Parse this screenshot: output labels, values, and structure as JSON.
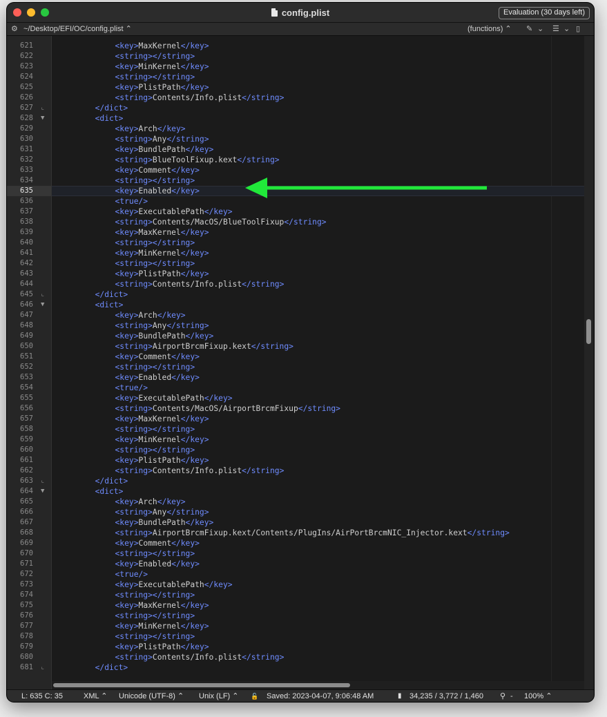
{
  "window": {
    "title": "config.plist",
    "evaluation_badge": "Evaluation (30 days left)"
  },
  "toolbar": {
    "gear_icon": "⚙",
    "path": "~/Desktop/EFI/OC/config.plist ⌃",
    "functions": "(functions) ⌃",
    "pin_icon": "✎",
    "chevron1": "⌄",
    "list_icon": "☰",
    "chevron2": "⌄",
    "doc_icon": "▯"
  },
  "editor": {
    "current_line": 635,
    "lines": [
      {
        "n": "621",
        "indent": 5,
        "p": [
          [
            "t",
            "<key>"
          ],
          [
            "x",
            "MaxKernel"
          ],
          [
            "t",
            "</key>"
          ]
        ]
      },
      {
        "n": "622",
        "indent": 5,
        "p": [
          [
            "t",
            "<string></string>"
          ]
        ]
      },
      {
        "n": "623",
        "indent": 5,
        "p": [
          [
            "t",
            "<key>"
          ],
          [
            "x",
            "MinKernel"
          ],
          [
            "t",
            "</key>"
          ]
        ]
      },
      {
        "n": "624",
        "indent": 5,
        "p": [
          [
            "t",
            "<string></string>"
          ]
        ]
      },
      {
        "n": "625",
        "indent": 5,
        "p": [
          [
            "t",
            "<key>"
          ],
          [
            "x",
            "PlistPath"
          ],
          [
            "t",
            "</key>"
          ]
        ]
      },
      {
        "n": "626",
        "indent": 5,
        "p": [
          [
            "t",
            "<string>"
          ],
          [
            "x",
            "Contents/Info.plist"
          ],
          [
            "t",
            "</string>"
          ]
        ]
      },
      {
        "n": "627",
        "indent": 4,
        "fold": "close",
        "p": [
          [
            "t",
            "</dict>"
          ]
        ]
      },
      {
        "n": "628",
        "indent": 4,
        "fold": "open",
        "p": [
          [
            "t",
            "<dict>"
          ]
        ]
      },
      {
        "n": "629",
        "indent": 5,
        "p": [
          [
            "t",
            "<key>"
          ],
          [
            "x",
            "Arch"
          ],
          [
            "t",
            "</key>"
          ]
        ]
      },
      {
        "n": "630",
        "indent": 5,
        "p": [
          [
            "t",
            "<string>"
          ],
          [
            "x",
            "Any"
          ],
          [
            "t",
            "</string>"
          ]
        ]
      },
      {
        "n": "631",
        "indent": 5,
        "p": [
          [
            "t",
            "<key>"
          ],
          [
            "x",
            "BundlePath"
          ],
          [
            "t",
            "</key>"
          ]
        ]
      },
      {
        "n": "632",
        "indent": 5,
        "p": [
          [
            "t",
            "<string>"
          ],
          [
            "x",
            "BlueToolFixup.kext"
          ],
          [
            "t",
            "</string>"
          ]
        ]
      },
      {
        "n": "633",
        "indent": 5,
        "p": [
          [
            "t",
            "<key>"
          ],
          [
            "x",
            "Comment"
          ],
          [
            "t",
            "</key>"
          ]
        ]
      },
      {
        "n": "634",
        "indent": 5,
        "p": [
          [
            "t",
            "<string></string>"
          ]
        ]
      },
      {
        "n": "635",
        "indent": 5,
        "p": [
          [
            "t",
            "<key>"
          ],
          [
            "x",
            "Enabled"
          ],
          [
            "t",
            "</key>"
          ]
        ]
      },
      {
        "n": "636",
        "indent": 5,
        "p": [
          [
            "t",
            "<true/>"
          ]
        ]
      },
      {
        "n": "637",
        "indent": 5,
        "p": [
          [
            "t",
            "<key>"
          ],
          [
            "x",
            "ExecutablePath"
          ],
          [
            "t",
            "</key>"
          ]
        ]
      },
      {
        "n": "638",
        "indent": 5,
        "p": [
          [
            "t",
            "<string>"
          ],
          [
            "x",
            "Contents/MacOS/BlueToolFixup"
          ],
          [
            "t",
            "</string>"
          ]
        ]
      },
      {
        "n": "639",
        "indent": 5,
        "p": [
          [
            "t",
            "<key>"
          ],
          [
            "x",
            "MaxKernel"
          ],
          [
            "t",
            "</key>"
          ]
        ]
      },
      {
        "n": "640",
        "indent": 5,
        "p": [
          [
            "t",
            "<string></string>"
          ]
        ]
      },
      {
        "n": "641",
        "indent": 5,
        "p": [
          [
            "t",
            "<key>"
          ],
          [
            "x",
            "MinKernel"
          ],
          [
            "t",
            "</key>"
          ]
        ]
      },
      {
        "n": "642",
        "indent": 5,
        "p": [
          [
            "t",
            "<string></string>"
          ]
        ]
      },
      {
        "n": "643",
        "indent": 5,
        "p": [
          [
            "t",
            "<key>"
          ],
          [
            "x",
            "PlistPath"
          ],
          [
            "t",
            "</key>"
          ]
        ]
      },
      {
        "n": "644",
        "indent": 5,
        "p": [
          [
            "t",
            "<string>"
          ],
          [
            "x",
            "Contents/Info.plist"
          ],
          [
            "t",
            "</string>"
          ]
        ]
      },
      {
        "n": "645",
        "indent": 4,
        "fold": "close",
        "p": [
          [
            "t",
            "</dict>"
          ]
        ]
      },
      {
        "n": "646",
        "indent": 4,
        "fold": "open",
        "p": [
          [
            "t",
            "<dict>"
          ]
        ]
      },
      {
        "n": "647",
        "indent": 5,
        "p": [
          [
            "t",
            "<key>"
          ],
          [
            "x",
            "Arch"
          ],
          [
            "t",
            "</key>"
          ]
        ]
      },
      {
        "n": "648",
        "indent": 5,
        "p": [
          [
            "t",
            "<string>"
          ],
          [
            "x",
            "Any"
          ],
          [
            "t",
            "</string>"
          ]
        ]
      },
      {
        "n": "649",
        "indent": 5,
        "p": [
          [
            "t",
            "<key>"
          ],
          [
            "x",
            "BundlePath"
          ],
          [
            "t",
            "</key>"
          ]
        ]
      },
      {
        "n": "650",
        "indent": 5,
        "p": [
          [
            "t",
            "<string>"
          ],
          [
            "x",
            "AirportBrcmFixup.kext"
          ],
          [
            "t",
            "</string>"
          ]
        ]
      },
      {
        "n": "651",
        "indent": 5,
        "p": [
          [
            "t",
            "<key>"
          ],
          [
            "x",
            "Comment"
          ],
          [
            "t",
            "</key>"
          ]
        ]
      },
      {
        "n": "652",
        "indent": 5,
        "p": [
          [
            "t",
            "<string></string>"
          ]
        ]
      },
      {
        "n": "653",
        "indent": 5,
        "p": [
          [
            "t",
            "<key>"
          ],
          [
            "x",
            "Enabled"
          ],
          [
            "t",
            "</key>"
          ]
        ]
      },
      {
        "n": "654",
        "indent": 5,
        "p": [
          [
            "t",
            "<true/>"
          ]
        ]
      },
      {
        "n": "655",
        "indent": 5,
        "p": [
          [
            "t",
            "<key>"
          ],
          [
            "x",
            "ExecutablePath"
          ],
          [
            "t",
            "</key>"
          ]
        ]
      },
      {
        "n": "656",
        "indent": 5,
        "p": [
          [
            "t",
            "<string>"
          ],
          [
            "x",
            "Contents/MacOS/AirportBrcmFixup"
          ],
          [
            "t",
            "</string>"
          ]
        ]
      },
      {
        "n": "657",
        "indent": 5,
        "p": [
          [
            "t",
            "<key>"
          ],
          [
            "x",
            "MaxKernel"
          ],
          [
            "t",
            "</key>"
          ]
        ]
      },
      {
        "n": "658",
        "indent": 5,
        "p": [
          [
            "t",
            "<string></string>"
          ]
        ]
      },
      {
        "n": "659",
        "indent": 5,
        "p": [
          [
            "t",
            "<key>"
          ],
          [
            "x",
            "MinKernel"
          ],
          [
            "t",
            "</key>"
          ]
        ]
      },
      {
        "n": "660",
        "indent": 5,
        "p": [
          [
            "t",
            "<string></string>"
          ]
        ]
      },
      {
        "n": "661",
        "indent": 5,
        "p": [
          [
            "t",
            "<key>"
          ],
          [
            "x",
            "PlistPath"
          ],
          [
            "t",
            "</key>"
          ]
        ]
      },
      {
        "n": "662",
        "indent": 5,
        "p": [
          [
            "t",
            "<string>"
          ],
          [
            "x",
            "Contents/Info.plist"
          ],
          [
            "t",
            "</string>"
          ]
        ]
      },
      {
        "n": "663",
        "indent": 4,
        "fold": "close",
        "p": [
          [
            "t",
            "</dict>"
          ]
        ]
      },
      {
        "n": "664",
        "indent": 4,
        "fold": "open",
        "p": [
          [
            "t",
            "<dict>"
          ]
        ]
      },
      {
        "n": "665",
        "indent": 5,
        "p": [
          [
            "t",
            "<key>"
          ],
          [
            "x",
            "Arch"
          ],
          [
            "t",
            "</key>"
          ]
        ]
      },
      {
        "n": "666",
        "indent": 5,
        "p": [
          [
            "t",
            "<string>"
          ],
          [
            "x",
            "Any"
          ],
          [
            "t",
            "</string>"
          ]
        ]
      },
      {
        "n": "667",
        "indent": 5,
        "p": [
          [
            "t",
            "<key>"
          ],
          [
            "x",
            "BundlePath"
          ],
          [
            "t",
            "</key>"
          ]
        ]
      },
      {
        "n": "668",
        "indent": 5,
        "p": [
          [
            "t",
            "<string>"
          ],
          [
            "x",
            "AirportBrcmFixup.kext/Contents/PlugIns/AirPortBrcmNIC_Injector.kext"
          ],
          [
            "t",
            "</string>"
          ]
        ]
      },
      {
        "n": "669",
        "indent": 5,
        "p": [
          [
            "t",
            "<key>"
          ],
          [
            "x",
            "Comment"
          ],
          [
            "t",
            "</key>"
          ]
        ]
      },
      {
        "n": "670",
        "indent": 5,
        "p": [
          [
            "t",
            "<string></string>"
          ]
        ]
      },
      {
        "n": "671",
        "indent": 5,
        "p": [
          [
            "t",
            "<key>"
          ],
          [
            "x",
            "Enabled"
          ],
          [
            "t",
            "</key>"
          ]
        ]
      },
      {
        "n": "672",
        "indent": 5,
        "p": [
          [
            "t",
            "<true/>"
          ]
        ]
      },
      {
        "n": "673",
        "indent": 5,
        "p": [
          [
            "t",
            "<key>"
          ],
          [
            "x",
            "ExecutablePath"
          ],
          [
            "t",
            "</key>"
          ]
        ]
      },
      {
        "n": "674",
        "indent": 5,
        "p": [
          [
            "t",
            "<string></string>"
          ]
        ]
      },
      {
        "n": "675",
        "indent": 5,
        "p": [
          [
            "t",
            "<key>"
          ],
          [
            "x",
            "MaxKernel"
          ],
          [
            "t",
            "</key>"
          ]
        ]
      },
      {
        "n": "676",
        "indent": 5,
        "p": [
          [
            "t",
            "<string></string>"
          ]
        ]
      },
      {
        "n": "677",
        "indent": 5,
        "p": [
          [
            "t",
            "<key>"
          ],
          [
            "x",
            "MinKernel"
          ],
          [
            "t",
            "</key>"
          ]
        ]
      },
      {
        "n": "678",
        "indent": 5,
        "p": [
          [
            "t",
            "<string></string>"
          ]
        ]
      },
      {
        "n": "679",
        "indent": 5,
        "p": [
          [
            "t",
            "<key>"
          ],
          [
            "x",
            "PlistPath"
          ],
          [
            "t",
            "</key>"
          ]
        ]
      },
      {
        "n": "680",
        "indent": 5,
        "p": [
          [
            "t",
            "<string>"
          ],
          [
            "x",
            "Contents/Info.plist"
          ],
          [
            "t",
            "</string>"
          ]
        ]
      },
      {
        "n": "681",
        "indent": 4,
        "fold": "close",
        "p": [
          [
            "t",
            "</dict>"
          ]
        ]
      }
    ]
  },
  "statusbar": {
    "position": "L: 635 C: 35",
    "syntax": "XML ⌃",
    "encoding": "Unicode (UTF-8) ⌃",
    "line_endings": "Unix (LF) ⌃",
    "lock_icon": "🔓",
    "saved": "Saved: 2023-04-07, 9:06:48 AM",
    "doc_icon": "▮",
    "stats": "34,235 / 3,772 / 1,460",
    "zoom_icon": "⚲",
    "zoom_minus": "-",
    "zoom": "100% ⌃"
  },
  "colors": {
    "tag": "#6f8cff",
    "text": "#cfcfcf",
    "annotation_arrow": "#21e83a"
  },
  "annotation": {
    "type": "arrow",
    "points_to_line": 635
  }
}
